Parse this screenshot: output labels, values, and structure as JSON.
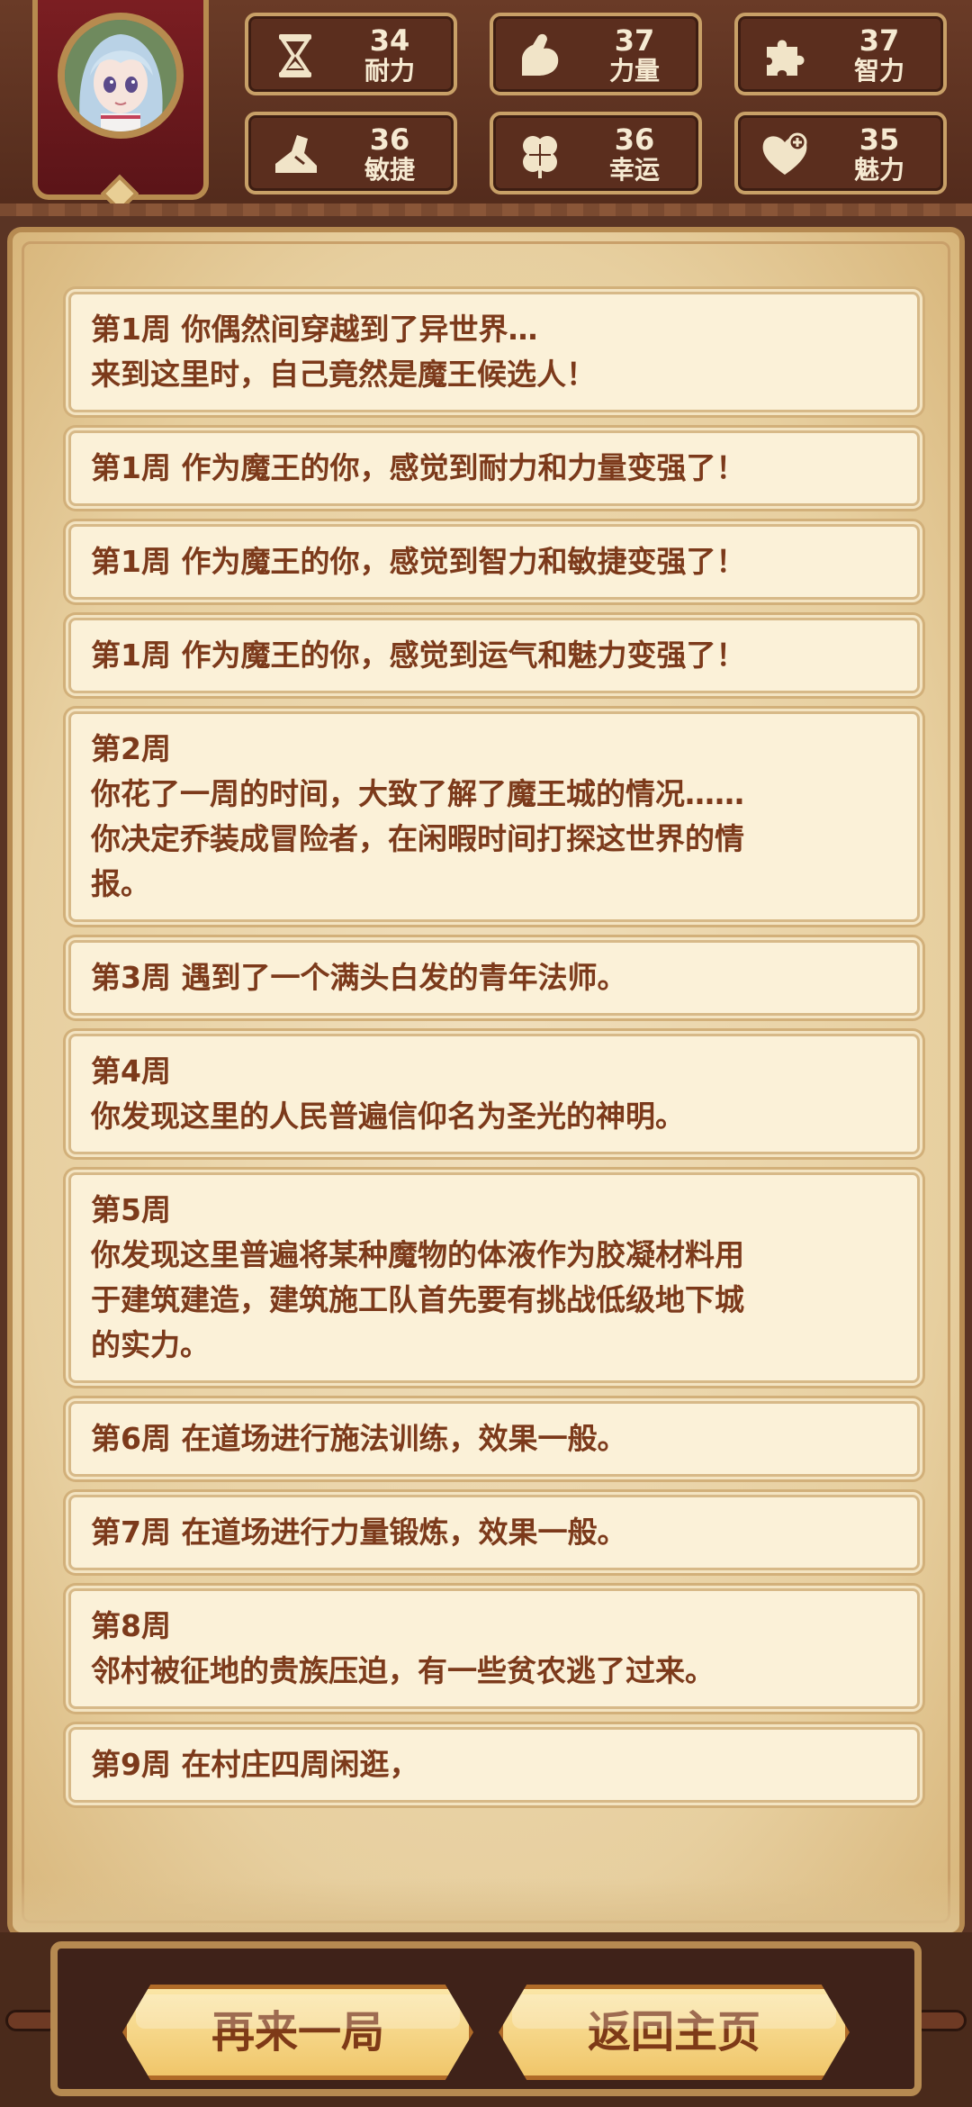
{
  "stats": [
    {
      "icon": "hourglass-icon",
      "value": "34",
      "label": "耐力"
    },
    {
      "icon": "flexed-arm-icon",
      "value": "37",
      "label": "力量"
    },
    {
      "icon": "puzzle-icon",
      "value": "37",
      "label": "智力"
    },
    {
      "icon": "boot-icon",
      "value": "36",
      "label": "敏捷"
    },
    {
      "icon": "clover-icon",
      "value": "36",
      "label": "幸运"
    },
    {
      "icon": "heart-plus-icon",
      "value": "35",
      "label": "魅力"
    }
  ],
  "log": [
    {
      "lines": [
        "第1周 你偶然间穿越到了异世界…",
        "来到这里时，自己竟然是魔王候选人！"
      ]
    },
    {
      "lines": [
        "第1周 作为魔王的你，感觉到耐力和力量变强了！"
      ]
    },
    {
      "lines": [
        "第1周 作为魔王的你，感觉到智力和敏捷变强了！"
      ]
    },
    {
      "lines": [
        "第1周 作为魔王的你，感觉到运气和魅力变强了！"
      ]
    },
    {
      "lines": [
        "第2周",
        "你花了一周的时间，大致了解了魔王城的情况……",
        "你决定乔装成冒险者，在闲暇时间打探这世界的情",
        "报。"
      ]
    },
    {
      "lines": [
        "第3周 遇到了一个满头白发的青年法师。"
      ]
    },
    {
      "lines": [
        "第4周",
        "你发现这里的人民普遍信仰名为圣光的神明。"
      ]
    },
    {
      "lines": [
        "第5周",
        "你发现这里普遍将某种魔物的体液作为胶凝材料用",
        "于建筑建造，建筑施工队首先要有挑战低级地下城",
        "的实力。"
      ]
    },
    {
      "lines": [
        "第6周 在道场进行施法训练，效果一般。"
      ]
    },
    {
      "lines": [
        "第7周 在道场进行力量锻炼，效果一般。"
      ]
    },
    {
      "lines": [
        "第8周",
        "邻村被征地的贵族压迫，有一些贫农逃了过来。"
      ]
    },
    {
      "lines": [
        "第9周 在村庄四周闲逛，"
      ]
    }
  ],
  "buttons": {
    "replay": "再来一局",
    "home": "返回主页"
  },
  "colors": {
    "stat_bg": "#5b2e1e",
    "log_text": "#7c3a1b",
    "button_bg": "#f0c66a"
  }
}
